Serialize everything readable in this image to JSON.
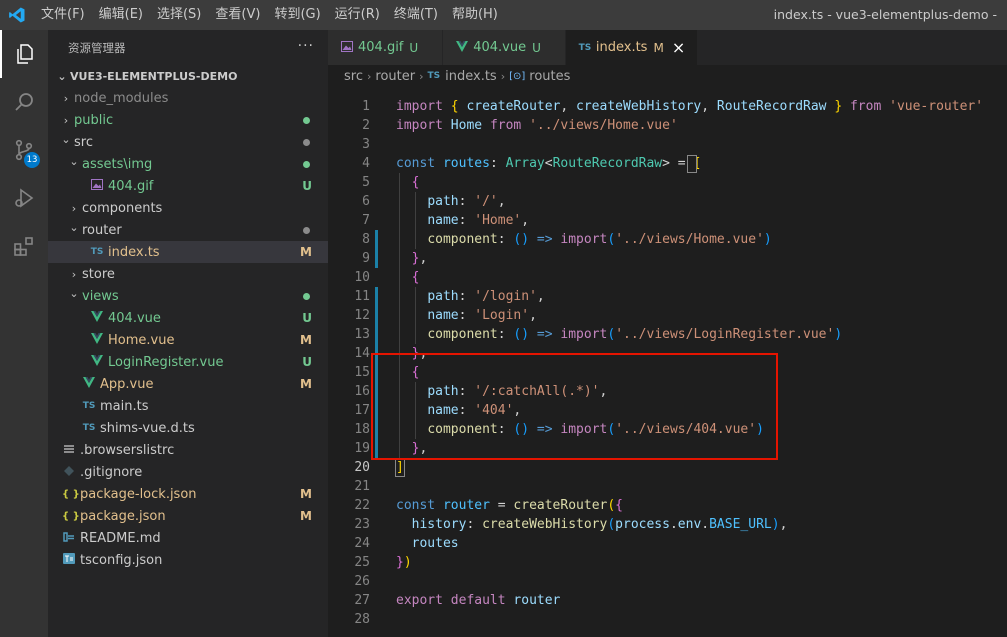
{
  "menu": [
    "文件(F)",
    "编辑(E)",
    "选择(S)",
    "查看(V)",
    "转到(G)",
    "运行(R)",
    "终端(T)",
    "帮助(H)"
  ],
  "window_title": "index.ts - vue3-elementplus-demo -",
  "activity": {
    "scm_badge": "13"
  },
  "sidebar": {
    "header": "资源管理器",
    "more": "···",
    "project": "VUE3-ELEMENTPLUS-DEMO",
    "tree": [
      {
        "label": "node_modules",
        "depth": 1,
        "kind": "folder",
        "open": false,
        "color": "#8b8b8b",
        "status": "",
        "dot": ""
      },
      {
        "label": "public",
        "depth": 1,
        "kind": "folder",
        "open": false,
        "color": "#73c991",
        "status": "",
        "dot": "#73c991"
      },
      {
        "label": "src",
        "depth": 1,
        "kind": "folder",
        "open": true,
        "color": "#cccccc",
        "status": "",
        "dot": "#8b8b8b"
      },
      {
        "label": "assets\\img",
        "depth": 2,
        "kind": "folder",
        "open": true,
        "color": "#73c991",
        "status": "",
        "dot": "#73c991"
      },
      {
        "label": "404.gif",
        "depth": 3,
        "kind": "gif",
        "open": false,
        "color": "#73c991",
        "status": "U",
        "dot": ""
      },
      {
        "label": "components",
        "depth": 2,
        "kind": "folder",
        "open": false,
        "color": "#cccccc",
        "status": "",
        "dot": ""
      },
      {
        "label": "router",
        "depth": 2,
        "kind": "folder",
        "open": true,
        "color": "#cccccc",
        "status": "",
        "dot": "#8b8b8b"
      },
      {
        "label": "index.ts",
        "depth": 3,
        "kind": "ts",
        "open": false,
        "color": "#e2c08d",
        "status": "M",
        "dot": "",
        "selected": true
      },
      {
        "label": "store",
        "depth": 2,
        "kind": "folder",
        "open": false,
        "color": "#cccccc",
        "status": "",
        "dot": ""
      },
      {
        "label": "views",
        "depth": 2,
        "kind": "folder",
        "open": true,
        "color": "#73c991",
        "status": "",
        "dot": "#73c991"
      },
      {
        "label": "404.vue",
        "depth": 3,
        "kind": "vue",
        "open": false,
        "color": "#73c991",
        "status": "U",
        "dot": ""
      },
      {
        "label": "Home.vue",
        "depth": 3,
        "kind": "vue",
        "open": false,
        "color": "#e2c08d",
        "status": "M",
        "dot": ""
      },
      {
        "label": "LoginRegister.vue",
        "depth": 3,
        "kind": "vue",
        "open": false,
        "color": "#73c991",
        "status": "U",
        "dot": ""
      },
      {
        "label": "App.vue",
        "depth": 2,
        "kind": "vue",
        "open": false,
        "color": "#e2c08d",
        "status": "M",
        "dot": ""
      },
      {
        "label": "main.ts",
        "depth": 2,
        "kind": "ts",
        "open": false,
        "color": "#cccccc",
        "status": "",
        "dot": ""
      },
      {
        "label": "shims-vue.d.ts",
        "depth": 2,
        "kind": "ts",
        "open": false,
        "color": "#cccccc",
        "status": "",
        "dot": ""
      },
      {
        "label": ".browserslistrc",
        "depth": 1,
        "kind": "lines",
        "open": false,
        "color": "#cccccc",
        "status": "",
        "dot": ""
      },
      {
        "label": ".gitignore",
        "depth": 1,
        "kind": "git",
        "open": false,
        "color": "#cccccc",
        "status": "",
        "dot": ""
      },
      {
        "label": "package-lock.json",
        "depth": 1,
        "kind": "json",
        "open": false,
        "color": "#e2c08d",
        "status": "M",
        "dot": ""
      },
      {
        "label": "package.json",
        "depth": 1,
        "kind": "json",
        "open": false,
        "color": "#e2c08d",
        "status": "M",
        "dot": ""
      },
      {
        "label": "README.md",
        "depth": 1,
        "kind": "md",
        "open": false,
        "color": "#cccccc",
        "status": "",
        "dot": ""
      },
      {
        "label": "tsconfig.json",
        "depth": 1,
        "kind": "tsconfig",
        "open": false,
        "color": "#cccccc",
        "status": "",
        "dot": ""
      }
    ]
  },
  "tabs": [
    {
      "label": "404.gif",
      "kind": "gif",
      "status": "U",
      "color": "#73c991",
      "active": false
    },
    {
      "label": "404.vue",
      "kind": "vue",
      "status": "U",
      "color": "#73c991",
      "active": false
    },
    {
      "label": "index.ts",
      "kind": "ts",
      "status": "M",
      "color": "#e2c08d",
      "active": true
    }
  ],
  "breadcrumb": [
    "src",
    "router",
    "index.ts",
    "routes"
  ],
  "icons": {
    "ts": "TS",
    "json": "{ }",
    "vue": "V",
    "close": "×",
    "routes": "[⊙]"
  },
  "code": [
    [
      [
        "import",
        "t-kw2"
      ],
      [
        " ",
        ""
      ],
      [
        "{",
        "t-b1"
      ],
      [
        " ",
        ""
      ],
      [
        "createRouter",
        "t-var"
      ],
      [
        ", ",
        "t-p"
      ],
      [
        "createWebHistory",
        "t-var"
      ],
      [
        ", ",
        "t-p"
      ],
      [
        "RouteRecordRaw",
        "t-var"
      ],
      [
        " ",
        ""
      ],
      [
        "}",
        "t-b1"
      ],
      [
        " ",
        ""
      ],
      [
        "from",
        "t-kw2"
      ],
      [
        " ",
        ""
      ],
      [
        "'vue-router'",
        "t-str"
      ]
    ],
    [
      [
        "import",
        "t-kw2"
      ],
      [
        " ",
        ""
      ],
      [
        "Home",
        "t-var"
      ],
      [
        " ",
        ""
      ],
      [
        "from",
        "t-kw2"
      ],
      [
        " ",
        ""
      ],
      [
        "'../views/Home.vue'",
        "t-str"
      ]
    ],
    [],
    [
      [
        "const",
        "t-kw"
      ],
      [
        " ",
        ""
      ],
      [
        "routes",
        "t-const"
      ],
      [
        ": ",
        "t-p"
      ],
      [
        "Array",
        "t-type"
      ],
      [
        "<",
        "t-p"
      ],
      [
        "RouteRecordRaw",
        "t-type"
      ],
      [
        "> = ",
        "t-p"
      ],
      [
        "[",
        "t-b1"
      ]
    ],
    [
      [
        "  ",
        ""
      ],
      [
        "{",
        "t-b2"
      ]
    ],
    [
      [
        "    ",
        ""
      ],
      [
        "path",
        "t-var"
      ],
      [
        ": ",
        "t-p"
      ],
      [
        "'/'",
        "t-str"
      ],
      [
        ",",
        "t-p"
      ]
    ],
    [
      [
        "    ",
        ""
      ],
      [
        "name",
        "t-var"
      ],
      [
        ": ",
        "t-p"
      ],
      [
        "'Home'",
        "t-str"
      ],
      [
        ",",
        "t-p"
      ]
    ],
    [
      [
        "    ",
        ""
      ],
      [
        "component",
        "t-fn"
      ],
      [
        ": ",
        "t-p"
      ],
      [
        "()",
        "t-b3"
      ],
      [
        " => ",
        "t-kw"
      ],
      [
        "import",
        "t-kw2"
      ],
      [
        "(",
        "t-b3"
      ],
      [
        "'../views/Home.vue'",
        "t-str"
      ],
      [
        ")",
        "t-b3"
      ]
    ],
    [
      [
        "  ",
        ""
      ],
      [
        "}",
        "t-b2"
      ],
      [
        ",",
        "t-p"
      ]
    ],
    [
      [
        "  ",
        ""
      ],
      [
        "{",
        "t-b2"
      ]
    ],
    [
      [
        "    ",
        ""
      ],
      [
        "path",
        "t-var"
      ],
      [
        ": ",
        "t-p"
      ],
      [
        "'/login'",
        "t-str"
      ],
      [
        ",",
        "t-p"
      ]
    ],
    [
      [
        "    ",
        ""
      ],
      [
        "name",
        "t-var"
      ],
      [
        ": ",
        "t-p"
      ],
      [
        "'Login'",
        "t-str"
      ],
      [
        ",",
        "t-p"
      ]
    ],
    [
      [
        "    ",
        ""
      ],
      [
        "component",
        "t-fn"
      ],
      [
        ": ",
        "t-p"
      ],
      [
        "()",
        "t-b3"
      ],
      [
        " => ",
        "t-kw"
      ],
      [
        "import",
        "t-kw2"
      ],
      [
        "(",
        "t-b3"
      ],
      [
        "'../views/LoginRegister.vue'",
        "t-str"
      ],
      [
        ")",
        "t-b3"
      ]
    ],
    [
      [
        "  ",
        ""
      ],
      [
        "}",
        "t-b2"
      ],
      [
        ",",
        "t-p"
      ]
    ],
    [
      [
        "  ",
        ""
      ],
      [
        "{",
        "t-b2"
      ]
    ],
    [
      [
        "    ",
        ""
      ],
      [
        "path",
        "t-var"
      ],
      [
        ": ",
        "t-p"
      ],
      [
        "'/:catchAll(.*)'",
        "t-str"
      ],
      [
        ",",
        "t-p"
      ]
    ],
    [
      [
        "    ",
        ""
      ],
      [
        "name",
        "t-var"
      ],
      [
        ": ",
        "t-p"
      ],
      [
        "'404'",
        "t-str"
      ],
      [
        ",",
        "t-p"
      ]
    ],
    [
      [
        "    ",
        ""
      ],
      [
        "component",
        "t-fn"
      ],
      [
        ": ",
        "t-p"
      ],
      [
        "()",
        "t-b3"
      ],
      [
        " => ",
        "t-kw"
      ],
      [
        "import",
        "t-kw2"
      ],
      [
        "(",
        "t-b3"
      ],
      [
        "'../views/404.vue'",
        "t-str"
      ],
      [
        ")",
        "t-b3"
      ]
    ],
    [
      [
        "  ",
        ""
      ],
      [
        "}",
        "t-b2"
      ],
      [
        ",",
        "t-p"
      ]
    ],
    [
      [
        "]",
        "t-b1"
      ]
    ],
    [],
    [
      [
        "const",
        "t-kw"
      ],
      [
        " ",
        ""
      ],
      [
        "router",
        "t-const"
      ],
      [
        " = ",
        "t-p"
      ],
      [
        "createRouter",
        "t-fn"
      ],
      [
        "(",
        "t-b1"
      ],
      [
        "{",
        "t-b2"
      ]
    ],
    [
      [
        "  ",
        ""
      ],
      [
        "history",
        "t-var"
      ],
      [
        ": ",
        "t-p"
      ],
      [
        "createWebHistory",
        "t-fn"
      ],
      [
        "(",
        "t-b3"
      ],
      [
        "process",
        "t-var"
      ],
      [
        ".",
        "t-p"
      ],
      [
        "env",
        "t-var"
      ],
      [
        ".",
        "t-p"
      ],
      [
        "BASE_URL",
        "t-const"
      ],
      [
        ")",
        "t-b3"
      ],
      [
        ",",
        "t-p"
      ]
    ],
    [
      [
        "  ",
        ""
      ],
      [
        "routes",
        "t-var"
      ]
    ],
    [
      [
        "}",
        "t-b2"
      ],
      [
        ")",
        "t-b1"
      ]
    ],
    [],
    [
      [
        "export",
        "t-kw2"
      ],
      [
        " ",
        ""
      ],
      [
        "default",
        "t-kw2"
      ],
      [
        " ",
        ""
      ],
      [
        "router",
        "t-var"
      ]
    ],
    []
  ],
  "current_line": 20,
  "highlight": {
    "first_line": 15,
    "last_line": 19,
    "color": "#e51400"
  }
}
